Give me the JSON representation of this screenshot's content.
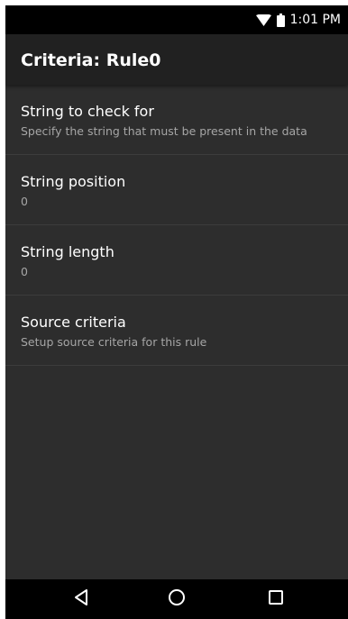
{
  "status_bar": {
    "time": "1:01 PM",
    "icons": [
      "wifi-icon",
      "battery-icon"
    ]
  },
  "app_bar": {
    "title": "Criteria: Rule0"
  },
  "preferences": [
    {
      "title": "String to check for",
      "summary": "Specify the string that must be present in the data"
    },
    {
      "title": "String position",
      "summary": "0"
    },
    {
      "title": "String length",
      "summary": "0"
    },
    {
      "title": "Source criteria",
      "summary": "Setup source criteria for this rule"
    }
  ],
  "nav_bar": {
    "buttons": [
      "back-icon",
      "home-icon",
      "recents-icon"
    ]
  },
  "colors": {
    "status_bar": "#000000",
    "app_bar": "#212121",
    "background": "#2d2d2d",
    "title_text": "#ffffff",
    "summary_text": "#a6a6a6"
  }
}
